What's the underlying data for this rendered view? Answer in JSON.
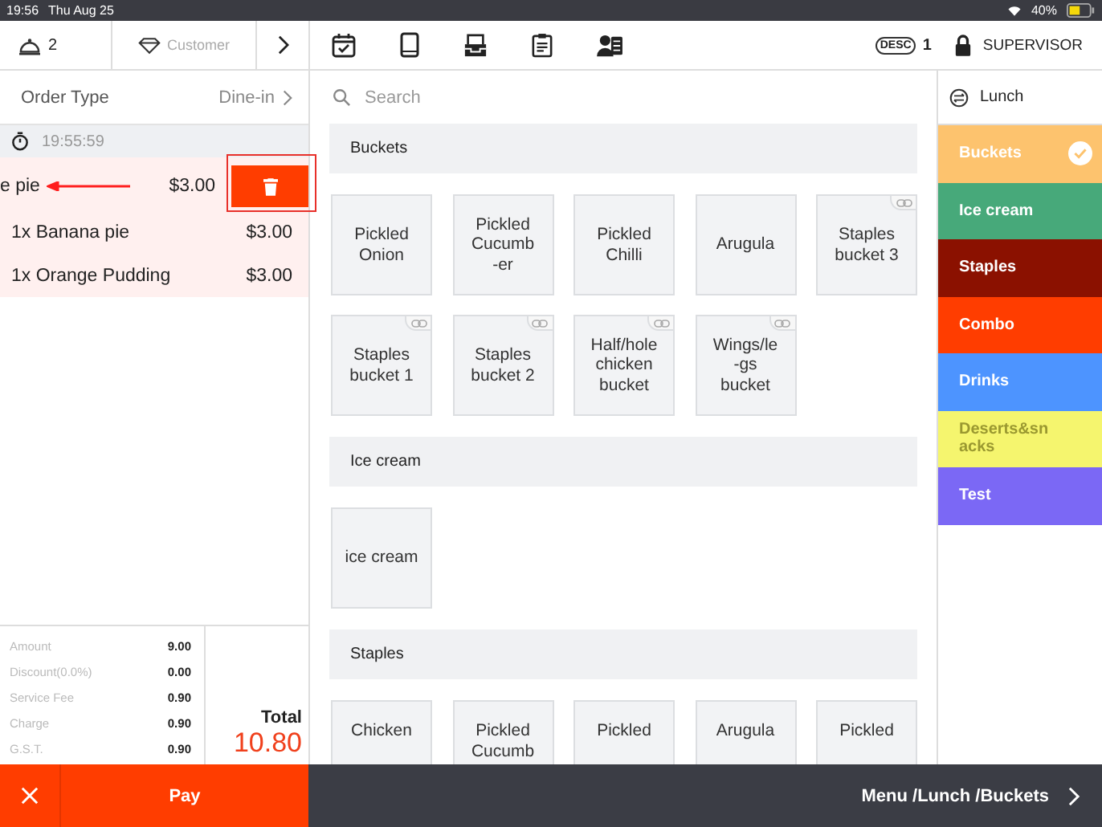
{
  "status_bar": {
    "time": "19:56",
    "date": "Thu Aug 25",
    "battery": "40%"
  },
  "header": {
    "table_count": "2",
    "customer": "Customer",
    "desc_badge": "DESC",
    "desc_count": "1",
    "role": "SUPERVISOR"
  },
  "order": {
    "type_label": "Order Type",
    "type_value": "Dine-in",
    "timer": "19:55:59",
    "items": [
      {
        "text": "e pie",
        "price": "$3.00",
        "swiped": true
      },
      {
        "text": "1x Banana pie",
        "price": "$3.00",
        "swiped": false
      },
      {
        "text": "1x Orange Pudding",
        "price": "$3.00",
        "swiped": false
      }
    ]
  },
  "summary": {
    "lines": [
      {
        "label": "Amount",
        "value": "9.00"
      },
      {
        "label": "Discount(0.0%)",
        "value": "0.00"
      },
      {
        "label": "Service Fee",
        "value": "0.90"
      },
      {
        "label": "Charge",
        "value": "0.90"
      },
      {
        "label": "G.S.T.",
        "value": "0.90"
      }
    ],
    "total_label": "Total",
    "total": "10.80"
  },
  "actions": {
    "pay": "Pay"
  },
  "search": {
    "placeholder": "Search"
  },
  "sections": [
    {
      "title": "Buckets",
      "products": [
        {
          "name": "Pickled\nOnion",
          "linked": false
        },
        {
          "name": "Pickled\nCucumb\n-er",
          "linked": false
        },
        {
          "name": "Pickled\nChilli",
          "linked": false
        },
        {
          "name": "Arugula",
          "linked": false
        },
        {
          "name": "Staples\nbucket  3",
          "linked": true
        },
        {
          "name": "Staples\nbucket  1",
          "linked": true
        },
        {
          "name": "Staples\nbucket  2",
          "linked": true
        },
        {
          "name": "Half/hole\nchicken\nbucket",
          "linked": true
        },
        {
          "name": "Wings/le\n-gs\nbucket",
          "linked": true
        }
      ]
    },
    {
      "title": "Ice cream",
      "products": [
        {
          "name": "ice  cream",
          "linked": false
        }
      ]
    },
    {
      "title": "Staples",
      "products": [
        {
          "name": "Chicken",
          "linked": false
        },
        {
          "name": "Pickled\nCucumb",
          "linked": false
        },
        {
          "name": "Pickled",
          "linked": false
        },
        {
          "name": "Arugula",
          "linked": false
        },
        {
          "name": "Pickled",
          "linked": false
        }
      ]
    }
  ],
  "menu": {
    "title": "Lunch",
    "categories": [
      {
        "name": "Buckets",
        "color": "#fdc36e",
        "selected": true
      },
      {
        "name": "Ice cream",
        "color": "#47a97a",
        "selected": false
      },
      {
        "name": "Staples",
        "color": "#8b1100",
        "selected": false
      },
      {
        "name": "Combo",
        "color": "#ff3d00",
        "selected": false
      },
      {
        "name": "Drinks",
        "color": "#4d94ff",
        "selected": false
      },
      {
        "name": "Deserts&sn\nacks",
        "color": "#f5f56e",
        "selected": false
      },
      {
        "name": "Test",
        "color": "#7b68f5",
        "selected": false
      }
    ]
  },
  "breadcrumb": "Menu /Lunch /Buckets"
}
